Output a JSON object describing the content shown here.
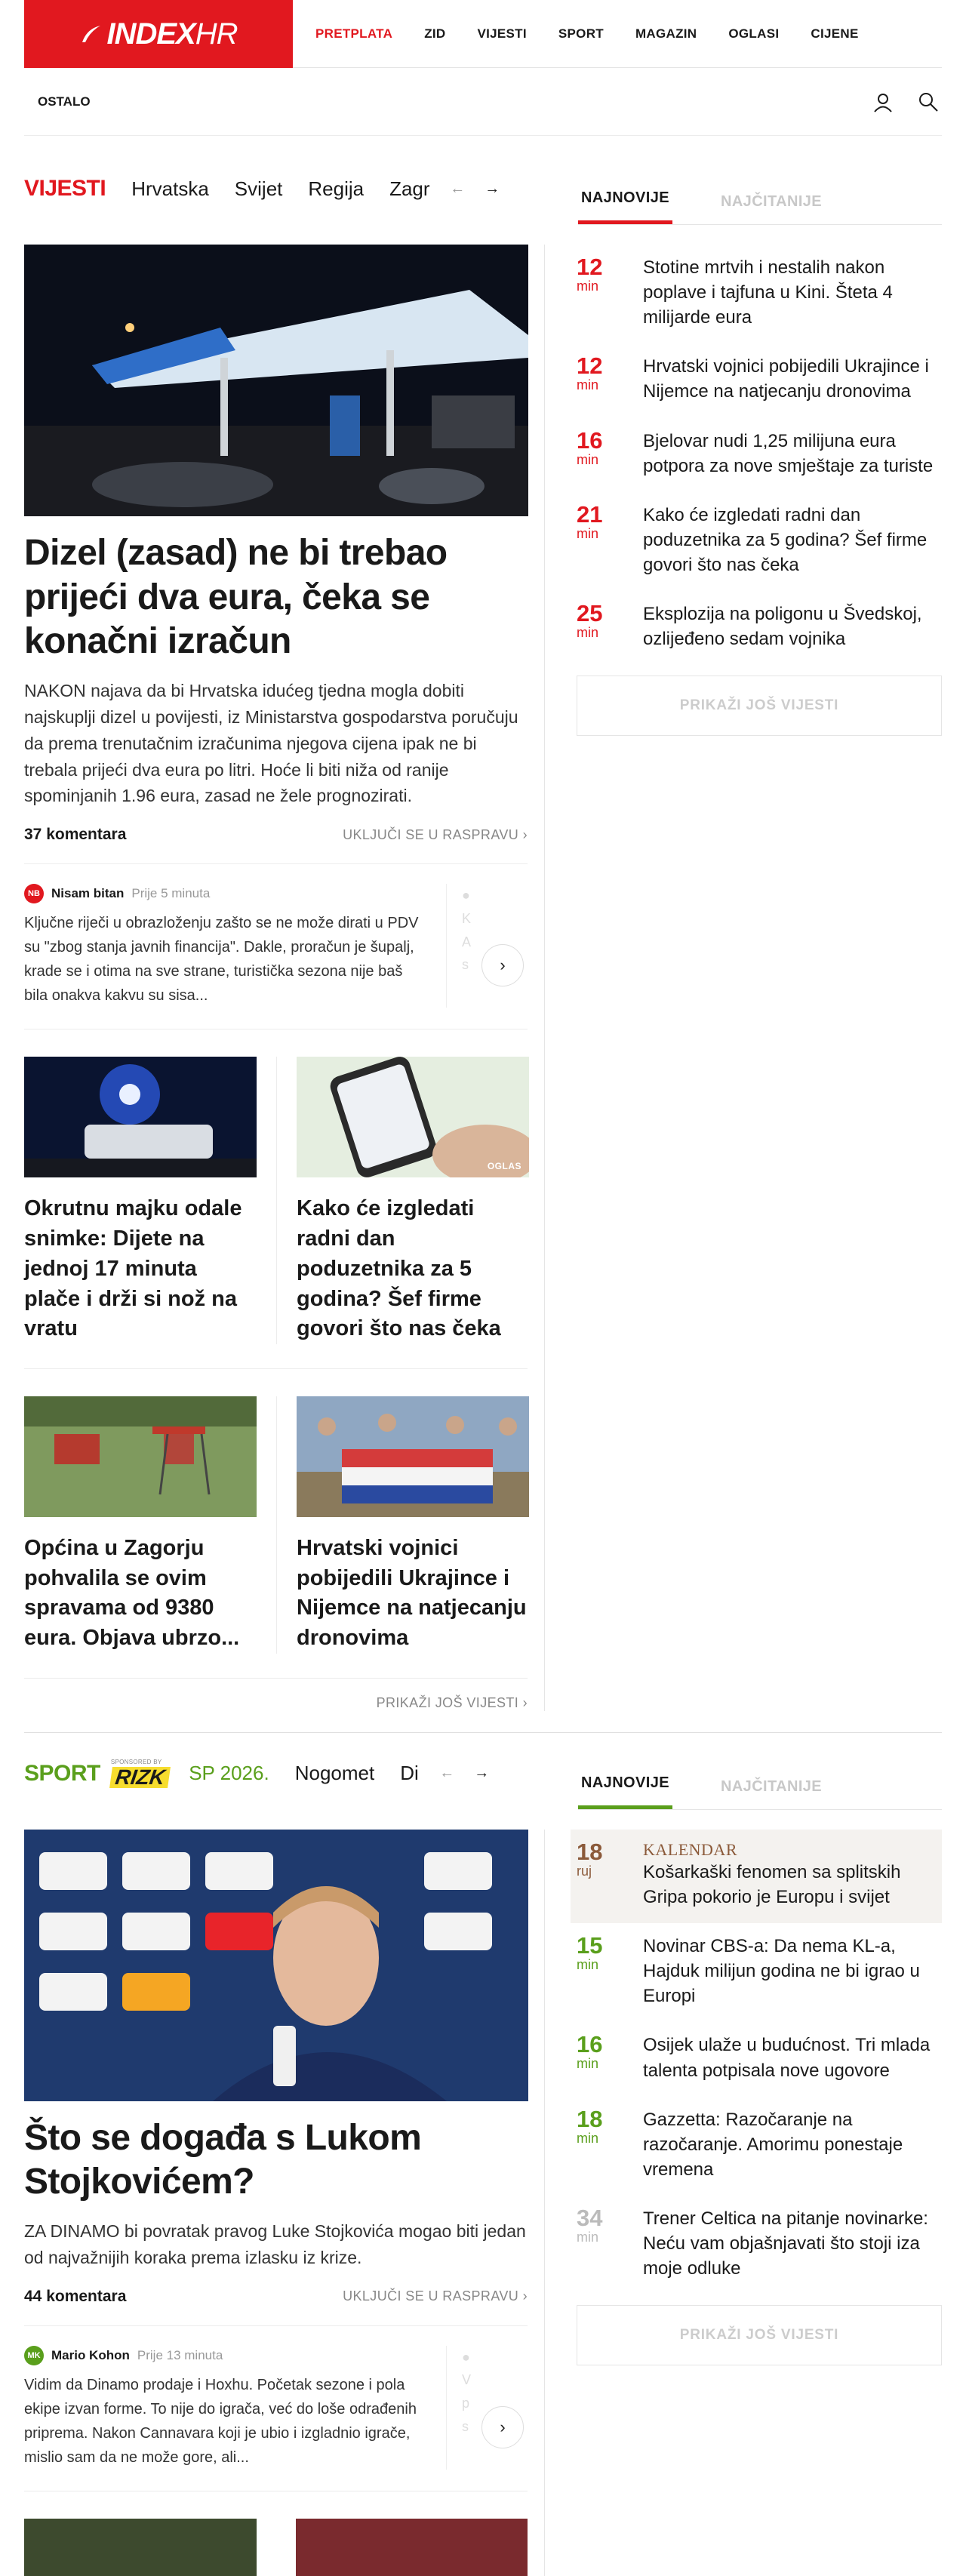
{
  "brand": {
    "name_main": "INDEX",
    "name_suffix": "HR",
    "color": "#e1181f"
  },
  "topnav": [
    "PRETPLATA",
    "ZID",
    "VIJESTI",
    "SPORT",
    "MAGAZIN",
    "OGLASI",
    "CIJENE"
  ],
  "subheader": {
    "item": "OSTALO",
    "icons": [
      "user-icon",
      "search-icon"
    ]
  },
  "news": {
    "section": "VIJESTI",
    "subnav": [
      "Hrvatska",
      "Svijet",
      "Regija",
      "Zagr"
    ],
    "tabs": {
      "active": "NAJNOVIJE",
      "inactive": "NAJČITANIJE"
    },
    "lead": {
      "title": "Dizel (zasad) ne bi trebao prijeći dva eura, čeka se konačni izračun",
      "text": "NAKON najava da bi Hrvatska idućeg tjedna mogla dobiti najskuplji dizel u povijesti, iz Ministarstva gospodarstva poručuju da prema trenutačnim izračunima njegova cijena ipak ne bi trebala prijeći dva eura po litri. Hoće li biti niža od ranije spominjanih 1.96 eura, zasad ne žele prognozirati.",
      "comments": "37 komentara",
      "join": "UKLJUČI SE U RASPRAVU ›"
    },
    "comment": {
      "initials": "NB",
      "author": "Nisam bitan",
      "time": "Prije 5 minuta",
      "text": "Ključne riječi u obrazloženju zašto se ne može dirati u PDV su \"zbog stanja javnih financija\". Dakle, proračun je šupalj, krade se i otima na sve strane, turistička sezona nije baš bila onakva kakvu su sisa...",
      "avatar_color": "#e1181f"
    },
    "cards": [
      {
        "title": "Okrutnu majku odale snimke: Dijete na jednoj 17 minuta plače i drži si nož na vratu",
        "badge": ""
      },
      {
        "title": "Kako će izgledati radni dan poduzetnika za 5 godina? Šef firme govori što nas čeka",
        "badge": "OGLAS"
      },
      {
        "title": "Općina u Zagorju pohvalila se ovim spravama od 9380 eura. Objava ubrzo...",
        "badge": ""
      },
      {
        "title": "Hrvatski vojnici pobijedili Ukrajince i Nijemce na natjecanju dronovima",
        "badge": ""
      }
    ],
    "more_main": "PRIKAŽI JOŠ VIJESTI ›",
    "latest": [
      {
        "n": "12",
        "u": "min",
        "title": "Stotine mrtvih i nestalih nakon poplave i tajfuna u Kini. Šteta 4 milijarde eura"
      },
      {
        "n": "12",
        "u": "min",
        "title": "Hrvatski vojnici pobijedili Ukrajince i Nijemce na natjecanju dronovima"
      },
      {
        "n": "16",
        "u": "min",
        "title": "Bjelovar nudi 1,25 milijuna eura potpora za nove smještaje za turiste"
      },
      {
        "n": "21",
        "u": "min",
        "title": "Kako će izgledati radni dan poduzetnika za 5 godina? Šef firme govori što nas čeka"
      },
      {
        "n": "25",
        "u": "min",
        "title": "Eksplozija na poligonu u Švedskoj, ozlijeđeno sedam vojnika"
      }
    ],
    "more_side": "PRIKAŽI JOŠ VIJESTI"
  },
  "sport": {
    "section": "SPORT",
    "sponsored_by": "SPONSORED BY",
    "sponsor": "RIZK",
    "subnav": [
      "SP 2026.",
      "Nogomet",
      "Di"
    ],
    "tabs": {
      "active": "NAJNOVIJE",
      "inactive": "NAJČITANIJE"
    },
    "lead": {
      "title": "Što se događa s Lukom Stojkovićem?",
      "text": "ZA DINAMO bi povratak pravog Luke Stojkovića mogao biti jedan od najvažnijih koraka prema izlasku iz krize.",
      "comments": "44 komentara",
      "join": "UKLJUČI SE U RASPRAVU ›"
    },
    "comment": {
      "initials": "MK",
      "author": "Mario Kohon",
      "time": "Prije 13 minuta",
      "text": "Vidim da Dinamo prodaje i Hoxhu. Početak sezone i pola ekipe izvan forme. To nije do igrača, već do loše odrađenih priprema. Nakon Cannavara koji je ubio i izgladnio igrače, mislio sam da ne može gore, ali...",
      "avatar_color": "#5a9f1c"
    },
    "latest": [
      {
        "n": "18",
        "u": "ruj",
        "tag": "KALENDAR",
        "title": "Košarkaški fenomen sa splitskih Gripa pokorio je Europu i svijet"
      },
      {
        "n": "15",
        "u": "min",
        "title": "Novinar CBS-a: Da nema KL-a, Hajduk milijun godina ne bi igrao u Europi"
      },
      {
        "n": "16",
        "u": "min",
        "title": "Osijek ulaže u budućnost. Tri mlada talenta potpisala nove ugovore"
      },
      {
        "n": "18",
        "u": "min",
        "title": "Gazzetta: Razočaranje na razočaranje. Amorimu ponestaje vremena"
      },
      {
        "n": "34",
        "u": "min",
        "title": "Trener Celtica na pitanje novinarke: Neću vam objašnjavati što stoji iza moje odluke"
      }
    ],
    "more_side": "PRIKAŽI JOŠ VIJESTI"
  }
}
